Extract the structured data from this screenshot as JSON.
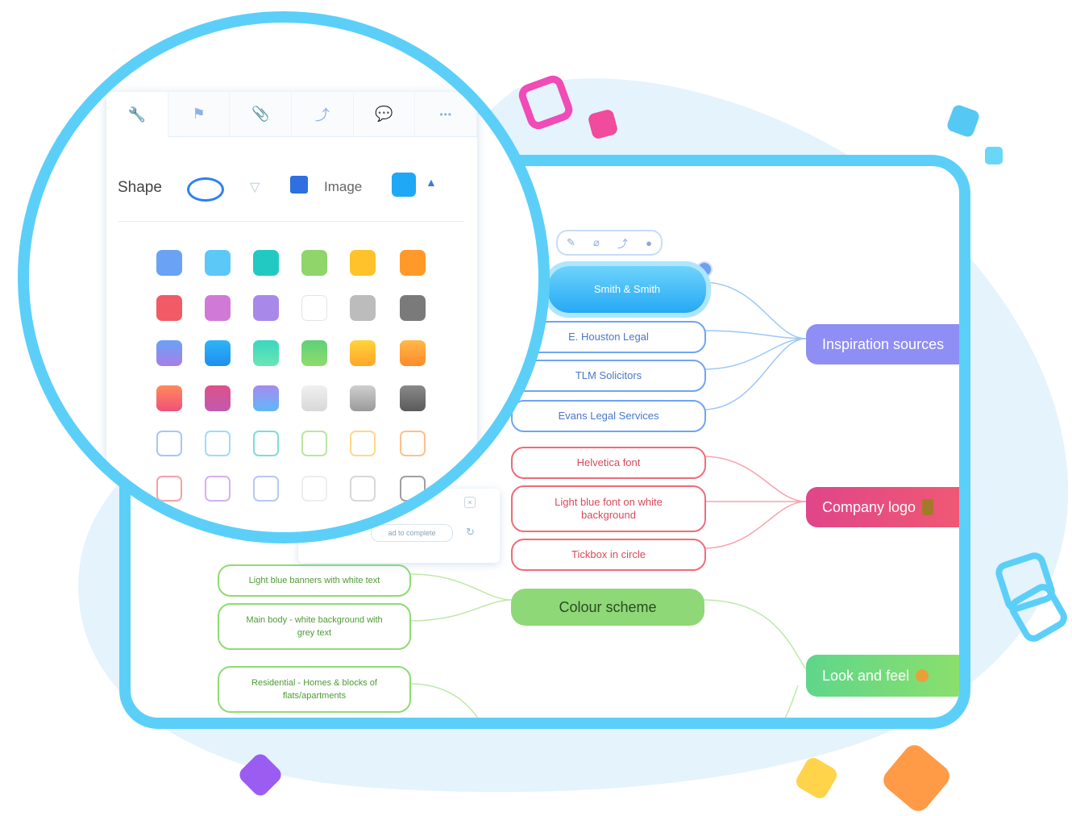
{
  "colors": {
    "accent": "#5ccff9",
    "blue": "#6fa4f5",
    "red": "#f06b79",
    "green": "#8edc72",
    "purple_hub": "#8f8ef5",
    "pink_hub": "#e84a86",
    "green_hub": "#7ed676"
  },
  "toolbar": {
    "tabs": [
      {
        "icon": "wrench-icon",
        "glyph": "🔧"
      },
      {
        "icon": "flag-icon",
        "glyph": "⚑"
      },
      {
        "icon": "paperclip-icon",
        "glyph": "📎"
      },
      {
        "icon": "connector-icon",
        "glyph": "⤴"
      },
      {
        "icon": "comment-icon",
        "glyph": "💬"
      },
      {
        "icon": "more-icon",
        "glyph": "•••"
      }
    ],
    "shape_label": "Shape",
    "image_label": "Image",
    "selected_color": "#1fa8f5"
  },
  "palette": {
    "solid": [
      [
        "#6aa2f5",
        "#5cc8f7",
        "#22c9c2",
        "#8fd56a",
        "#ffc22a",
        "#ff9a2a"
      ],
      [
        "#f25a66",
        "#d07ad6",
        "#a889ea",
        "#ffffff",
        "#bcbcbc",
        "#7a7a7a"
      ]
    ],
    "gradient": [
      [
        [
          "#6aa2f5",
          "#a87ee8"
        ],
        [
          "#2fb4f7",
          "#1f8ef0"
        ],
        [
          "#3ad6c0",
          "#6be6b2"
        ],
        [
          "#5fd07a",
          "#8fdc6a"
        ],
        [
          "#ffd43a",
          "#ffa52a"
        ],
        [
          "#ffb84a",
          "#ff8a2a"
        ]
      ],
      [
        [
          "#ff8a5a",
          "#f0507a"
        ],
        [
          "#e0508a",
          "#c05ab0"
        ],
        [
          "#a58af0",
          "#5fb8f7"
        ],
        [
          "#f0f0f0",
          "#d8d8d8"
        ],
        [
          "#cfcfcf",
          "#9a9a9a"
        ],
        [
          "#8a8a8a",
          "#5a5a5a"
        ]
      ]
    ],
    "outline": [
      [
        "#a8c6f7",
        "#9fdcf8",
        "#7fdcd8",
        "#b8e6a0",
        "#ffd88a",
        "#ffc08a"
      ],
      [
        "#f7a0a8",
        "#d6b0e8",
        "#b8c8f0",
        "#eeeeee",
        "#d8d8d8",
        "#a0a0a0"
      ]
    ]
  },
  "panel_footer": {
    "progress_label": "ad to complete"
  },
  "mindmap": {
    "inspiration": {
      "hub": "Inspiration sources",
      "items": [
        "Smith & Smith",
        "E. Houston Legal",
        "TLM Solicitors",
        "Evans Legal Services"
      ]
    },
    "company_logo": {
      "hub": "Company logo",
      "items": [
        "Helvetica font",
        "Light blue font on white background",
        "Tickbox in circle"
      ]
    },
    "look_and_feel": {
      "hub": "Look and feel"
    },
    "colour_scheme": {
      "label": "Colour scheme",
      "items": [
        "Light blue banners with white text",
        "Main body - white background with grey text",
        "Residential - Homes & blocks of flats/apartments"
      ]
    }
  }
}
